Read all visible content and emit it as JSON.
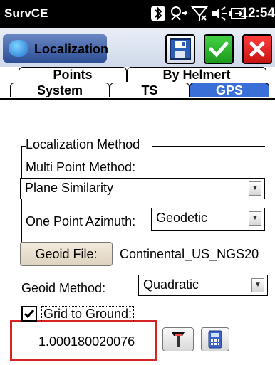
{
  "status_bar": {
    "app_name": "SurvCE",
    "time": "12:54"
  },
  "title_bar": {
    "title": "Localization"
  },
  "tabs": {
    "row1": [
      "Points",
      "By Helmert"
    ],
    "row2": [
      "System",
      "TS",
      "GPS"
    ],
    "active": "GPS"
  },
  "localization_method": {
    "group_title": "Localization Method",
    "multi_point_label": "Multi Point Method:",
    "multi_point_value": "Plane Similarity",
    "one_point_label": "One Point Azimuth:",
    "one_point_value": "Geodetic"
  },
  "geoid": {
    "file_button": "Geoid File:",
    "file_name": "Continental_US_NGS20",
    "method_label": "Geoid Method:",
    "method_value": "Quadratic"
  },
  "grid_to_ground": {
    "label": "Grid to Ground:",
    "checked": true,
    "value": "1.000180020076"
  },
  "colors": {
    "accent_tab": "#3a6fd8",
    "highlight_box": "#d42424",
    "ok_green": "#22bb22",
    "cancel_red": "#e02020"
  }
}
